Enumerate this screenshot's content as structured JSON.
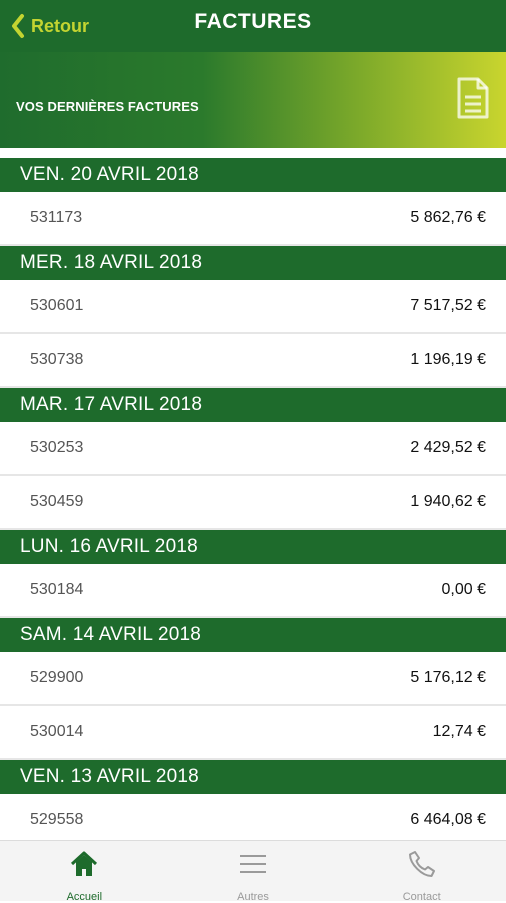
{
  "header": {
    "back_label": "Retour",
    "title": "FACTURES"
  },
  "banner": {
    "label": "VOS DERNIÈRES FACTURES"
  },
  "groups": [
    {
      "date": "VEN. 20 AVRIL 2018",
      "rows": [
        {
          "number": "531173",
          "amount": "5 862,76 €"
        }
      ]
    },
    {
      "date": "MER. 18 AVRIL 2018",
      "rows": [
        {
          "number": "530601",
          "amount": "7 517,52 €"
        },
        {
          "number": "530738",
          "amount": "1 196,19 €"
        }
      ]
    },
    {
      "date": "MAR. 17 AVRIL 2018",
      "rows": [
        {
          "number": "530253",
          "amount": "2 429,52 €"
        },
        {
          "number": "530459",
          "amount": "1 940,62 €"
        }
      ]
    },
    {
      "date": "LUN. 16 AVRIL 2018",
      "rows": [
        {
          "number": "530184",
          "amount": "0,00 €"
        }
      ]
    },
    {
      "date": "SAM. 14 AVRIL 2018",
      "rows": [
        {
          "number": "529900",
          "amount": "5 176,12 €"
        },
        {
          "number": "530014",
          "amount": "12,74 €"
        }
      ]
    },
    {
      "date": "VEN. 13 AVRIL 2018",
      "rows": [
        {
          "number": "529558",
          "amount": "6 464,08 €"
        }
      ]
    }
  ],
  "tabbar": {
    "tabs": [
      {
        "label": "Accueil",
        "icon": "home-icon",
        "active": true
      },
      {
        "label": "Autres",
        "icon": "menu-icon",
        "active": false
      },
      {
        "label": "Contact",
        "icon": "phone-icon",
        "active": false
      }
    ]
  },
  "colors": {
    "primary": "#1e6b2c",
    "accent": "#c3d431",
    "inactive": "#9a9a9a"
  }
}
